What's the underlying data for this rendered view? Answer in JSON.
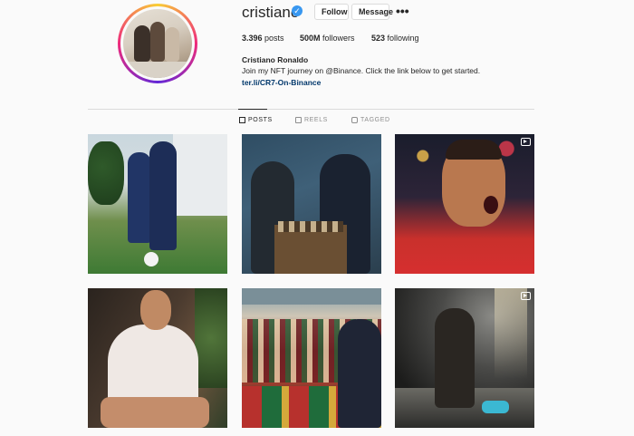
{
  "profile": {
    "username": "cristiano",
    "verified_glyph": "✓",
    "follow_label": "Follow",
    "message_label": "Message",
    "more_glyph": "•••",
    "stats": {
      "posts_value": "3.396",
      "posts_label": "posts",
      "followers_value": "500M",
      "followers_label": "followers",
      "following_value": "523",
      "following_label": "following"
    },
    "bio": {
      "name": "Cristiano Ronaldo",
      "text": "Join my NFT journey on @Binance. Click the link below to get started.",
      "link": "ter.li/CR7-On-Binance"
    }
  },
  "tabs": [
    {
      "label": "POSTS",
      "icon": "grid-icon",
      "active": true
    },
    {
      "label": "REELS",
      "icon": "reels-icon",
      "active": false
    },
    {
      "label": "TAGGED",
      "icon": "tagged-icon",
      "active": false
    }
  ],
  "posts": [
    {
      "content": "training on pitch",
      "video": false
    },
    {
      "content": "playing chess",
      "video": false
    },
    {
      "content": "celebration shout in red shirt",
      "video": true
    },
    {
      "content": "white t-shirt portrait",
      "video": false
    },
    {
      "content": "waving to fans",
      "video": false
    },
    {
      "content": "dark studio shoot",
      "video": true
    }
  ],
  "colors": {
    "verified": "#3897f0",
    "link": "#00376b",
    "text": "#262626",
    "muted": "#8e8e8e",
    "background": "#fafafa"
  }
}
